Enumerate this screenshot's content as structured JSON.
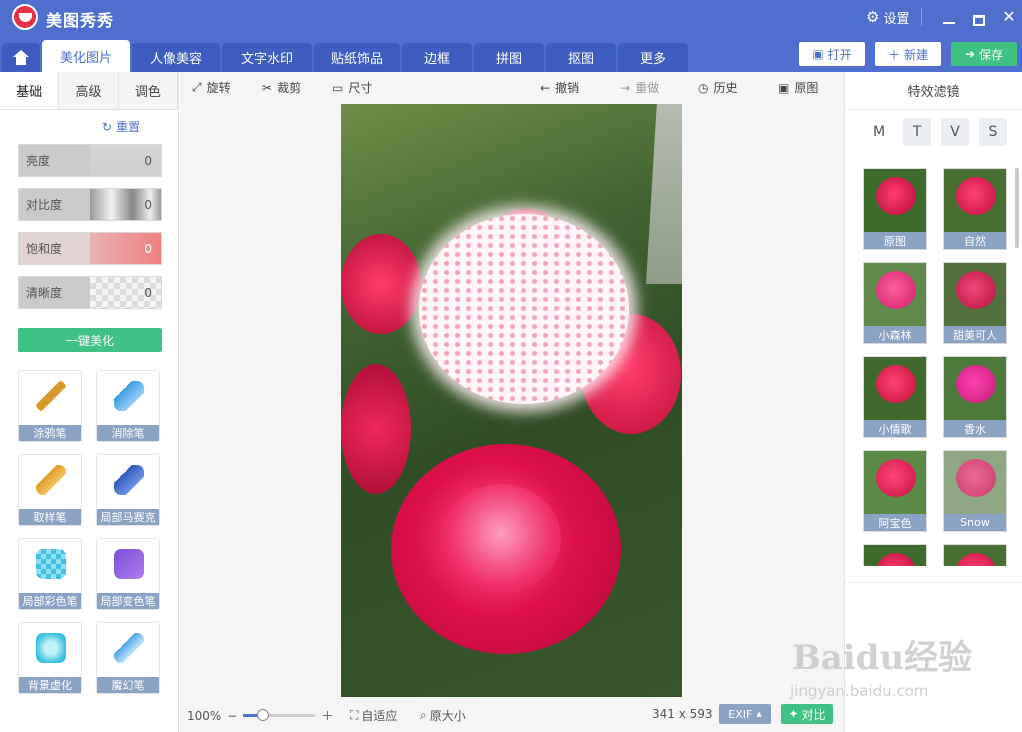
{
  "app": {
    "title": "美图秀秀"
  },
  "titlebar": {
    "settings": "设置"
  },
  "tabs": [
    "美化图片",
    "人像美容",
    "文字水印",
    "贴纸饰品",
    "边框",
    "拼图",
    "抠图",
    "更多"
  ],
  "actions": {
    "open": "打开",
    "new": "新建",
    "save": "保存"
  },
  "left": {
    "subtabs": [
      "基础",
      "高级",
      "调色"
    ],
    "reset": "重置",
    "sliders": [
      {
        "label": "亮度",
        "value": "0"
      },
      {
        "label": "对比度",
        "value": "0"
      },
      {
        "label": "饱和度",
        "value": "0"
      },
      {
        "label": "清晰度",
        "value": "0"
      }
    ],
    "one_key": "一键美化",
    "tools": [
      "涂鸦笔",
      "消除笔",
      "取样笔",
      "局部马赛克",
      "局部彩色笔",
      "局部变色笔",
      "背景虚化",
      "魔幻笔"
    ]
  },
  "toolbar": {
    "rotate": "旋转",
    "crop": "裁剪",
    "size": "尺寸",
    "undo": "撤销",
    "redo": "重做",
    "history": "历史",
    "original": "原图"
  },
  "status": {
    "zoom": "100%",
    "fit": "自适应",
    "actual": "原大小",
    "dimensions": "341 x 593",
    "exif": "EXIF",
    "compare": "对比"
  },
  "right": {
    "title": "特效滤镜",
    "letters": [
      "M",
      "T",
      "V",
      "S"
    ],
    "filters": [
      "原图",
      "自然",
      "小森林",
      "甜美可人",
      "小情歌",
      "香水",
      "阿宝色",
      "Snow"
    ]
  },
  "watermark": {
    "brand": "Baidu经验",
    "url": "jingyan.baidu.com"
  },
  "colors": {
    "titlebar": "#4f6fcf",
    "accent_green": "#3fc284",
    "label_blue": "#8aa2c4"
  }
}
